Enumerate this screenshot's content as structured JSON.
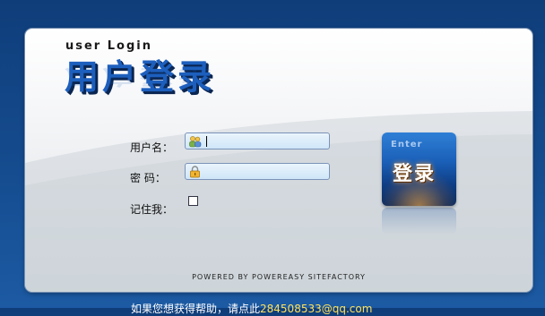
{
  "header": {
    "subtitle": "user Login",
    "title": "用户登录"
  },
  "form": {
    "username_label": "用户名：",
    "password_label": "密 码：",
    "remember_label": "记住我：",
    "username_value": "",
    "password_value": "",
    "remember_checked": false
  },
  "enter_button": {
    "small_label": "Enter",
    "label": "登录"
  },
  "footer": {
    "powered": "POWERED BY POWEREASY SITEFACTORY",
    "help_text": "如果您想获得帮助，请点此",
    "help_email": "284508533@qq.com"
  },
  "icons": {
    "username_icon": "users-icon",
    "password_icon": "lock-icon"
  },
  "colors": {
    "background": "#154c8f",
    "accent": "#1d5fbd",
    "field_bg": "#d8ecfa",
    "help_link": "#ffe15a"
  }
}
